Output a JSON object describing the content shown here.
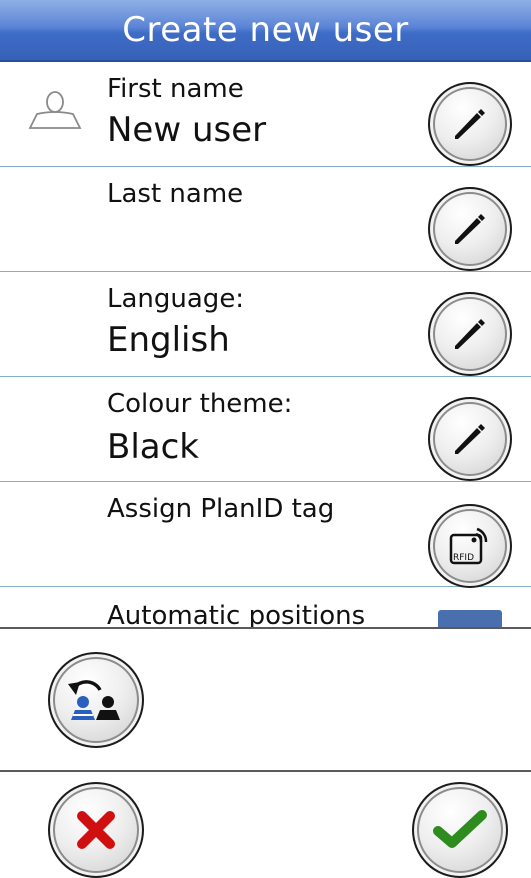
{
  "header": {
    "title": "Create new user"
  },
  "rows": {
    "first_name": {
      "label": "First name",
      "value": "New user"
    },
    "last_name": {
      "label": "Last name",
      "value": ""
    },
    "language": {
      "label": "Language:",
      "value": "English"
    },
    "colour_theme": {
      "label": "Colour theme:",
      "value": "Black"
    },
    "planid": {
      "label": "Assign PlanID tag",
      "icon_text": "RFID"
    },
    "automatic_positions": {
      "label": "Automatic positions"
    }
  },
  "colors": {
    "header_blue": "#3e6cc6",
    "separator": "#7fb0c8",
    "cancel_red": "#d01010",
    "confirm_green": "#2e8b1e",
    "user_blue": "#2a5fc0"
  },
  "icons": {
    "avatar": "user-outline-icon",
    "edit": "pencil-icon",
    "rfid": "rfid-tag-icon",
    "copy_user": "copy-user-icon",
    "cancel": "cross-icon",
    "confirm": "checkmark-icon"
  }
}
